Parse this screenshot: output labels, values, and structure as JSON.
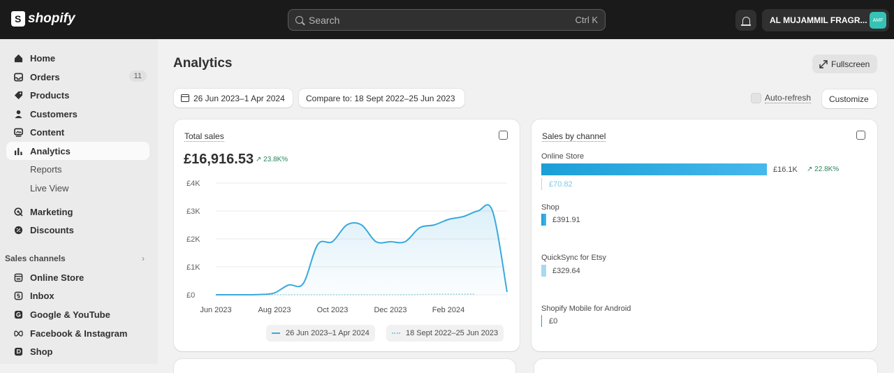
{
  "topbar": {
    "brand": "shopify",
    "search_placeholder": "Search",
    "search_shortcut": "Ctrl K",
    "store_name": "AL MUJAMMIL FRAGR...",
    "avatar_initials": "AMF"
  },
  "sidebar": {
    "items": [
      {
        "label": "Home",
        "icon": "home-icon"
      },
      {
        "label": "Orders",
        "icon": "inbox-tray-icon",
        "badge": "11"
      },
      {
        "label": "Products",
        "icon": "tag-icon"
      },
      {
        "label": "Customers",
        "icon": "person-icon"
      },
      {
        "label": "Content",
        "icon": "image-icon"
      },
      {
        "label": "Analytics",
        "icon": "bar-chart-icon"
      },
      {
        "label": "Reports"
      },
      {
        "label": "Live View"
      },
      {
        "label": "Marketing",
        "icon": "target-icon"
      },
      {
        "label": "Discounts",
        "icon": "discount-icon"
      }
    ],
    "sales_channels_label": "Sales channels",
    "channels": [
      {
        "label": "Online Store",
        "icon": "store-icon"
      },
      {
        "label": "Inbox",
        "icon": "inbox-icon"
      },
      {
        "label": "Google & YouTube",
        "icon": "google-icon"
      },
      {
        "label": "Facebook & Instagram",
        "icon": "meta-icon"
      },
      {
        "label": "Shop",
        "icon": "shop-icon"
      }
    ]
  },
  "header": {
    "title": "Analytics",
    "fullscreen_label": "Fullscreen",
    "date_range": "26 Jun 2023–1 Apr 2024",
    "compare_label": "Compare to: 18 Sept 2022–25 Jun 2023",
    "auto_refresh_label": "Auto-refresh",
    "customize_label": "Customize"
  },
  "total_sales": {
    "title": "Total sales",
    "value": "£16,916.53",
    "change": "23.8K%",
    "legend_current": "26 Jun 2023–1 Apr 2024",
    "legend_previous": "18 Sept 2022–25 Jun 2023"
  },
  "chart_data": {
    "type": "area",
    "x": [
      "Jun 2023",
      "Aug 2023",
      "Oct 2023",
      "Dec 2023",
      "Feb 2024"
    ],
    "y_ticks": [
      "£0",
      "£1K",
      "£2K",
      "£3K",
      "£4K"
    ],
    "ylim": [
      0,
      4000
    ],
    "series": [
      {
        "name": "26 Jun 2023–1 Apr 2024",
        "color": "#3aa9dc",
        "values": [
          0,
          0,
          0,
          10,
          60,
          350,
          400,
          1800,
          1900,
          2500,
          2500,
          1900,
          1900,
          1900,
          2400,
          2500,
          2700,
          2800,
          3000,
          3000,
          100
        ]
      },
      {
        "name": "18 Sept 2022–25 Jun 2023",
        "color": "#86ccea",
        "dotted": true,
        "values": [
          0,
          0,
          0,
          0,
          0,
          0,
          0,
          0,
          0,
          0,
          0,
          0,
          0,
          0,
          0,
          10,
          20,
          20,
          20,
          20
        ]
      }
    ]
  },
  "sales_by_channel": {
    "title": "Sales by channel",
    "channels": [
      {
        "name": "Online Store",
        "value": "£16.1K",
        "change": "22.8K%",
        "previous": "£70.82"
      },
      {
        "name": "Shop",
        "value": "£391.91"
      },
      {
        "name": "QuickSync for Etsy",
        "value": "£329.64"
      },
      {
        "name": "Shopify Mobile for Android",
        "value": "£0"
      }
    ]
  }
}
